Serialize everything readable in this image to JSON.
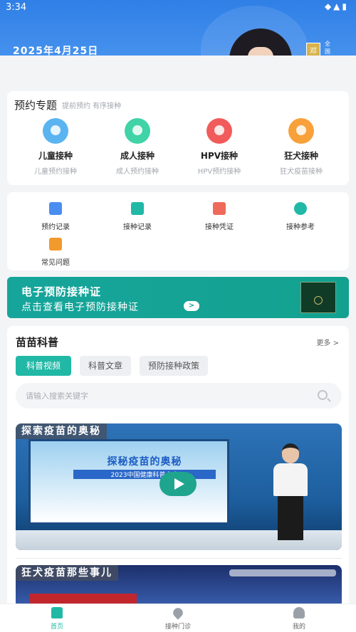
{
  "status_bar": {
    "time": "3:34",
    "icons": "◆▲▮"
  },
  "banner": {
    "date": "2025年4月25日",
    "tag": "邓",
    "tag2": "全国"
  },
  "topics": {
    "title": "预约专题",
    "subtitle": "提前预约 有序接种",
    "items": [
      {
        "label": "儿童接种",
        "sub": "儿童预约接种",
        "icon": "child-icon",
        "color": "#5ab4f0"
      },
      {
        "label": "成人接种",
        "sub": "成人预约接种",
        "icon": "adult-icon",
        "color": "#3fd3a7"
      },
      {
        "label": "HPV接种",
        "sub": "HPV预约接种",
        "icon": "hpv-icon",
        "color": "#f25b5b"
      },
      {
        "label": "狂犬接种",
        "sub": "狂犬疫苗接种",
        "icon": "rabies-icon",
        "color": "#f8a13a"
      }
    ]
  },
  "menu": {
    "items": [
      {
        "label": "预约记录",
        "icon": "appointment-record-icon",
        "color": "#4a8df0"
      },
      {
        "label": "接种记录",
        "icon": "vaccination-record-icon",
        "color": "#21b8a6"
      },
      {
        "label": "接种凭证",
        "icon": "certificate-icon",
        "color": "#ef6a5a"
      },
      {
        "label": "接种参考",
        "icon": "reference-icon",
        "color": "#21b8a6"
      },
      {
        "label": "常见问题",
        "icon": "faq-icon",
        "color": "#f29a2e"
      }
    ]
  },
  "cert_banner": {
    "title": "电子预防接种证",
    "subtitle": "点击查看电子预防接种证",
    "arrow": ">"
  },
  "science": {
    "title": "苗苗科普",
    "more": "更多 >",
    "tabs": [
      "科普视频",
      "科普文章",
      "预防接种政策"
    ],
    "active_tab": 0,
    "search_placeholder": "请输入搜索关键字",
    "videos": [
      {
        "title": "探索疫苗的奥秘",
        "screen_title": "探秘疫苗的奥秘",
        "screen_sub": "2023中国健康科普大赛"
      },
      {
        "title": "狂犬疫苗那些事儿"
      }
    ]
  },
  "bottom_nav": {
    "items": [
      {
        "label": "首页",
        "icon": "home-icon",
        "active": true
      },
      {
        "label": "接种门诊",
        "icon": "clinic-location-icon",
        "active": false
      },
      {
        "label": "我的",
        "icon": "profile-icon",
        "active": false
      }
    ]
  }
}
